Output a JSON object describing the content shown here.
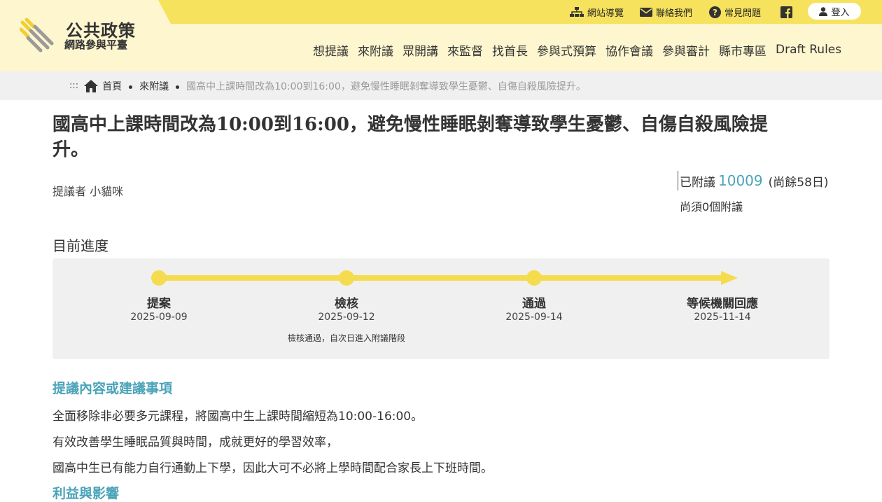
{
  "header": {
    "logo": {
      "title": "公共政策",
      "subtitle": "網路參與平臺"
    },
    "toplinks": {
      "sitemap": "網站導覽",
      "contact": "聯絡我們",
      "faq": "常見問題",
      "facebook_icon": "facebook-icon",
      "login": "登入"
    },
    "nav": [
      "想提議",
      "來附議",
      "眾開講",
      "來監督",
      "找首長",
      "參與式預算",
      "協作會議",
      "參與審計",
      "縣市專區",
      "Draft Rules"
    ]
  },
  "breadcrumb": {
    "dots": ":::",
    "home": "首頁",
    "section": "來附議",
    "current": "國高中上課時間改為10:00到16:00，避免慢性睡眠剝奪導致學生憂鬱、自傷自殺風險提升。"
  },
  "proposal": {
    "title": "國高中上課時間改為10:00到16:00，避免慢性睡眠剝奪導致學生憂鬱、自傷自殺風險提升。",
    "proposer_label": "提議者",
    "proposer_name": "小貓咪",
    "endorsed_label": "已附議",
    "endorsed_count": "10009",
    "days_left": "(尚餘58日)",
    "needed": "尚須0個附議"
  },
  "progress": {
    "heading": "目前進度",
    "percent_complete": 100,
    "steps": [
      {
        "label": "提案",
        "date": "2025-09-09",
        "note": ""
      },
      {
        "label": "檢核",
        "date": "2025-09-12",
        "note": "檢核通過，自次日進入附議階段"
      },
      {
        "label": "通過",
        "date": "2025-09-14",
        "note": ""
      },
      {
        "label": "等候機關回應",
        "date": "2025-11-14",
        "note": ""
      }
    ]
  },
  "content": {
    "section_title": "提議內容或建議事項",
    "paragraphs": [
      "全面移除非必要多元課程，將國高中生上課時間縮短為10:00-16:00。",
      "有效改善學生睡眠品質與時間，成就更好的學習效率，",
      "國高中生已有能力自行通勤上下學，因此大可不必將上學時間配合家長上下班時間。"
    ],
    "next_section_title": "利益與影響"
  },
  "colors": {
    "topbar": "#f6e25d",
    "header_bg": "#fdf6cf",
    "progress_yellow": "#f4dc4e",
    "accent_teal": "#4aa3b8"
  }
}
